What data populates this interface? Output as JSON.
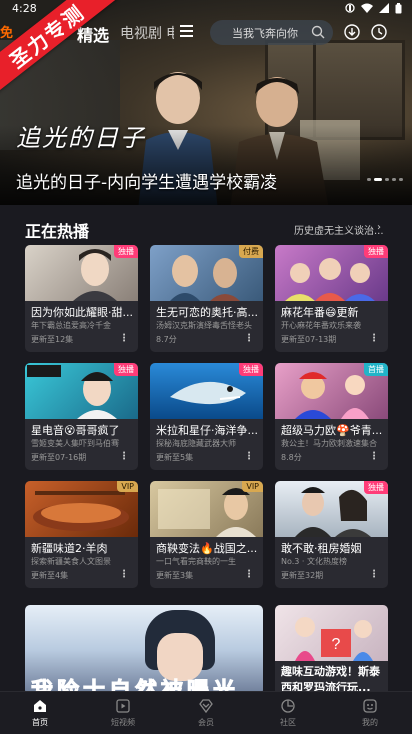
{
  "status": {
    "time": "4:28"
  },
  "ribbon": {
    "label": "圣力专测"
  },
  "nav": {
    "partial_tab": "免",
    "tabs": [
      "精选",
      "电视剧",
      "电"
    ],
    "search_placeholder": "当我飞奔向你"
  },
  "hero": {
    "logo_text": "追光的日子",
    "title": "追光的日子-内向学生遭遇学校霸凌"
  },
  "section": {
    "title": "正在热播",
    "more": "历史虚无主义谈治..."
  },
  "cards": [
    {
      "title": "因为你如此耀眼·甜...",
      "sub": "年下霸总追爱高冷千金",
      "ep": "更新至12集",
      "badge": "独播",
      "badge_color": "pink"
    },
    {
      "title": "生无可恋的奥托·高...",
      "sub": "汤姆汉克斯演绎毒舌怪老头",
      "ep": "8.7分",
      "badge": "付费",
      "badge_color": "gold"
    },
    {
      "title": "麻花年番😄更新",
      "sub": "开心麻花年番欢乐来袭",
      "ep": "更新至07-13期",
      "badge": "独播",
      "badge_color": "pink"
    },
    {
      "title": "星电音😵哥哥疯了",
      "sub": "雪姬变美人集吓到马伯骞",
      "ep": "更新至07-16期",
      "badge": "独播",
      "badge_color": "pink"
    },
    {
      "title": "米拉和星仔·海洋争...",
      "sub": "探秘海底隐藏武器大师",
      "ep": "更新至5集",
      "badge": "独播",
      "badge_color": "pink"
    },
    {
      "title": "超级马力欧🍄爷青...",
      "sub": "救公主！马力欧刺激速集合",
      "ep": "8.8分",
      "badge": "首播",
      "badge_color": "teal"
    },
    {
      "title": "新疆味道2·羊肉",
      "sub": "探索新疆美食人文图景",
      "ep": "更新至4集",
      "badge": "VIP",
      "badge_color": "gold"
    },
    {
      "title": "商鞅变法🔥战国之...",
      "sub": "一口气看完商鞅的一生",
      "ep": "更新至3集",
      "badge": "VIP",
      "badge_color": "gold"
    },
    {
      "title": "敢不敢·租房婚姻",
      "sub": "No.3 · 文化热度榜",
      "ep": "更新至32期",
      "badge": "独播",
      "badge_color": "pink"
    }
  ],
  "big_card": {
    "text": "我险士自然被曝光"
  },
  "tall_card": {
    "title": "趣味互动游戏！斯泰西和罗玛流行玩..."
  },
  "bottom": [
    {
      "label": "首页",
      "icon": "home-icon"
    },
    {
      "label": "短视频",
      "icon": "short-video-icon"
    },
    {
      "label": "会员",
      "icon": "vip-diamond-icon"
    },
    {
      "label": "社区",
      "icon": "community-icon"
    },
    {
      "label": "我的",
      "icon": "profile-icon"
    }
  ]
}
